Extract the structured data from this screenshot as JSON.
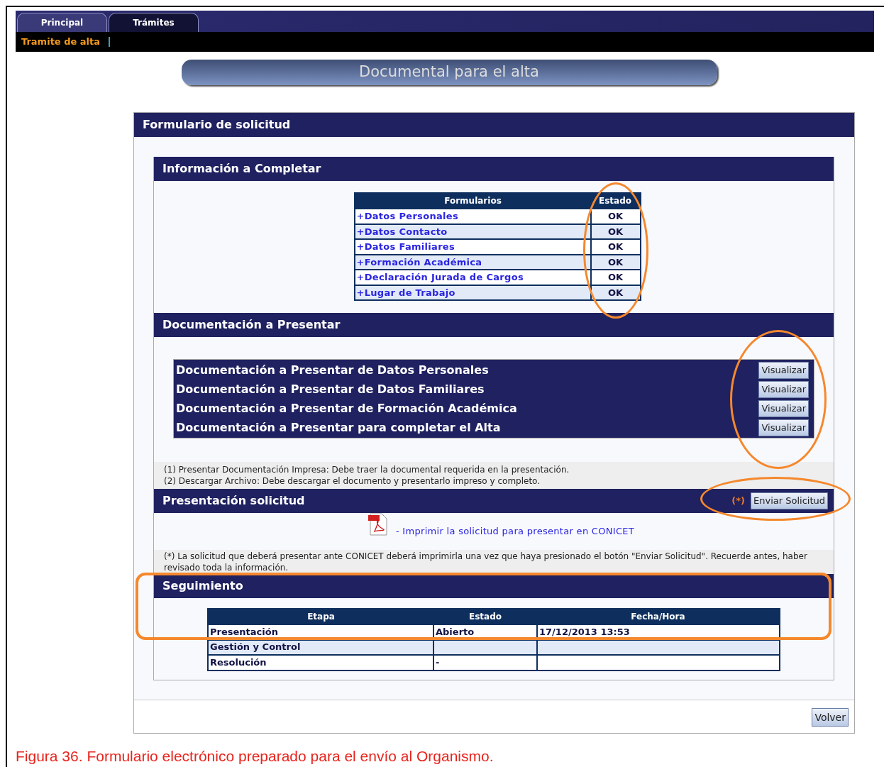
{
  "tabs": [
    {
      "label": "Principal",
      "selected": false
    },
    {
      "label": "Trámites",
      "selected": true
    }
  ],
  "breadcrumb": "Tramite de alta",
  "page_title": "Documental para el alta",
  "form": {
    "title": "Formulario de solicitud",
    "info": {
      "title": "Información a Completar",
      "columns": [
        "Formularios",
        "Estado"
      ],
      "rows": [
        {
          "name": "+Datos Personales",
          "status": "OK"
        },
        {
          "name": "+Datos Contacto",
          "status": "OK"
        },
        {
          "name": "+Datos Familiares",
          "status": "OK"
        },
        {
          "name": "+Formación Académica",
          "status": "OK"
        },
        {
          "name": "+Declaración Jurada de Cargos",
          "status": "OK"
        },
        {
          "name": "+Lugar de Trabajo",
          "status": "OK"
        }
      ]
    },
    "docs": {
      "title": "Documentación a Presentar",
      "items": [
        {
          "label": "Documentación a Presentar de Datos Personales",
          "button": "Visualizar"
        },
        {
          "label": "Documentación a Presentar de Datos Familiares",
          "button": "Visualizar"
        },
        {
          "label": "Documentación a Presentar de Formación Académica",
          "button": "Visualizar"
        },
        {
          "label": "Documentación a Presentar para completar el Alta",
          "button": "Visualizar"
        }
      ],
      "notes": [
        "(1) Presentar Documentación Impresa: Debe traer la documental requerida en la presentación.",
        "(2) Descargar Archivo: Debe descargar el documento y presentarlo impreso y completo."
      ]
    },
    "submission": {
      "title": "Presentación solicitud",
      "marker": "(*)",
      "button": "Enviar Solicitud",
      "print_link": "- Imprimir la solicitud para presentar en CONICET",
      "note": "(*) La solicitud que deberá presentar ante CONICET deberá imprimirla una vez que haya presionado el botón \"Enviar Solicitud\". Recuerde antes, haber revisado toda la información."
    },
    "tracking": {
      "title": "Seguimiento",
      "columns": [
        "Etapa",
        "Estado",
        "Fecha/Hora"
      ],
      "rows": [
        {
          "stage": "Presentación",
          "status": "Abierto",
          "date": "17/12/2013 13:53"
        },
        {
          "stage": "Gestión y Control"
        },
        {
          "stage": "Resolución",
          "status": "-"
        }
      ]
    },
    "back_button": "Volver"
  },
  "caption": "Figura 36. Formulario electrónico preparado para el envío al Organismo."
}
